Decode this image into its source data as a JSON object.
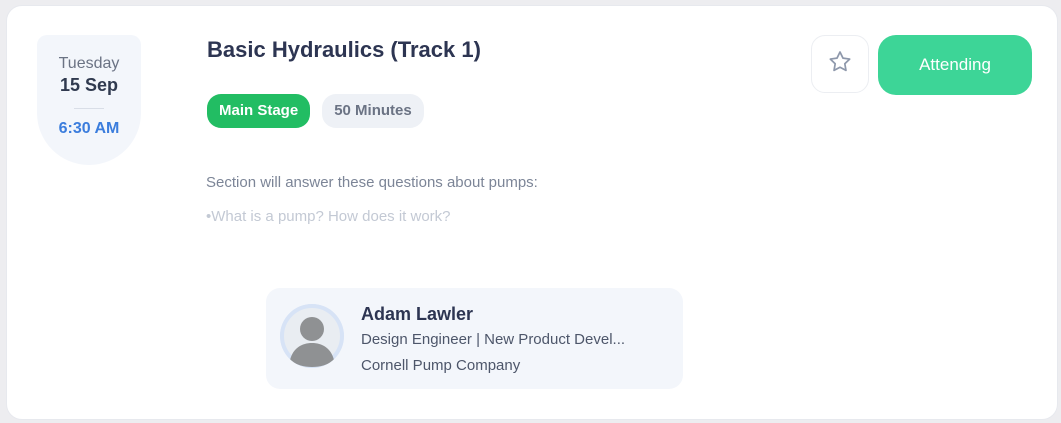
{
  "session": {
    "day": "Tuesday",
    "date": "15 Sep",
    "time": "6:30 AM",
    "title": "Basic Hydraulics (Track 1)",
    "stage_tag": "Main Stage",
    "duration_tag": "50 Minutes",
    "description_line1": "Section will answer these questions about pumps:",
    "description_line2": "•What is a pump? How does it work?"
  },
  "actions": {
    "favorite_icon": "star-outline-icon",
    "attend_label": "Attending"
  },
  "speaker": {
    "name": "Adam Lawler",
    "role": "Design Engineer | New Product Devel...",
    "company": "Cornell Pump Company",
    "avatar_icon": "default-avatar-icon"
  },
  "colors": {
    "accent_green": "#22bd63",
    "attend_green": "#3dd597",
    "time_blue": "#3b7ddd",
    "title_dark": "#2d3552"
  }
}
